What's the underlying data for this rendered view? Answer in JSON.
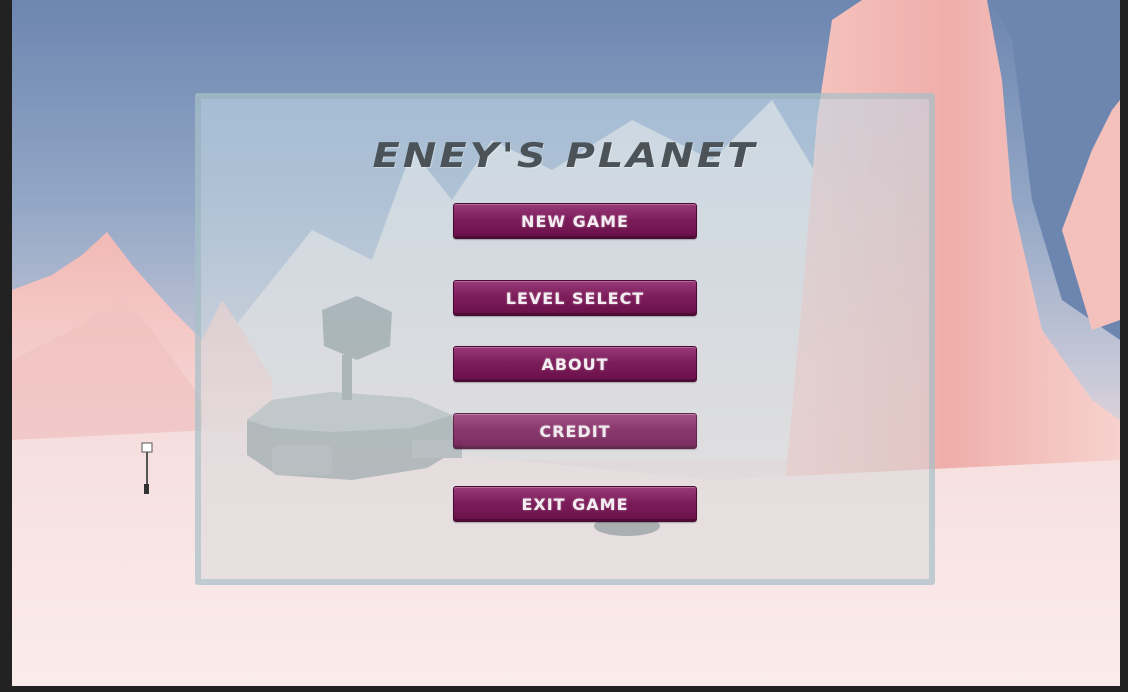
{
  "game": {
    "title": "ENEY'S PLANET"
  },
  "menu": {
    "new_game": "NEW GAME",
    "level_select": "LEVEL SELECT",
    "about": "ABOUT",
    "credit": "CREDIT",
    "exit_game": "EXIT GAME"
  },
  "colors": {
    "sky": "#6d86b0",
    "terrain": "#f3cfcf",
    "button": "#7c1d5a",
    "title": "#4b5358"
  }
}
